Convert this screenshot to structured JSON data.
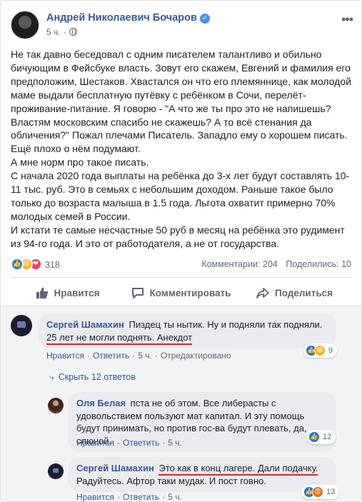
{
  "post": {
    "author": "Андрей Николаевич Бочаров",
    "time": "5 ч.",
    "paragraphs": [
      "Не так давно беседовал с одним писателем талантливо и обильно бичующим в Фейсбуке власть. Зовут его скажем, Евгений и фамилия его предположим, Шестаков. Хвастался он что его племяннице, как молодой маме выдали бесплатную путёвку с ребёнком в Сочи, перелёт-проживание-питание. Я говорю - \"А что же ты про это не напишешь? Властям московским спасибо не скажешь? А то всё стенания да обличения?\" Пожал плечами Писатель. Западло ему о хорошем писать. Ещё плохо о нём подумают.",
      "А мне норм про такое писать.",
      "С начала 2020 года выплаты на ребёнка до 3-х лет будут составлять 10-11 тыс. руб. Это в семьях с небольшим доходом. Раньше такое было только до возраста малыша в 1.5 года. Льгота охватит примерно 70% молодых семей в России.",
      "И кстати те самые несчастные 50 руб в месяц на ребёнка это рудимент из 94-го года. И это от работодателя, а не от государства."
    ],
    "reaction_count": "318",
    "comments_count": "Комментарии: 204",
    "shares_count": "Поделились: 10"
  },
  "actions": {
    "like": "Нравится",
    "comment": "Комментировать",
    "share": "Поделиться"
  },
  "comments": {
    "c1": {
      "name": "Сергей Шамахин",
      "text_a": "Пиздец ты нытик. Ну и подняли так подняли.",
      "text_b": "25 лет не могли поднять. Анекдот",
      "like": "Нравится",
      "reply": "Ответить",
      "time": "5 ч.",
      "edited": "Отредактировано",
      "reactions": "9"
    },
    "show_replies": "Скрыть 12 ответов",
    "r1": {
      "name": "Оля Белая",
      "text": "пста не об этом. Все либерасты с удовольствием пользуют мат капитал. И эту помощь будут принимать, но против гос-ва будут плевать, да, слюной.",
      "like": "Нравится",
      "reply": "Ответить",
      "time": "5 ч.",
      "reactions": "12"
    },
    "r2": {
      "name": "Сергей Шамахин",
      "text_a": "Это как в конц лагере. Дали подачку.",
      "text_b": "Радуйтесь. Афтор таки мудак. И пост говно.",
      "like": "Нравится",
      "reply": "Ответить",
      "time": "5 ч.",
      "reactions": "13"
    }
  },
  "colors": {
    "link": "#385898",
    "like_blue": "#1877f2",
    "annotation_red": "#d8262c"
  }
}
